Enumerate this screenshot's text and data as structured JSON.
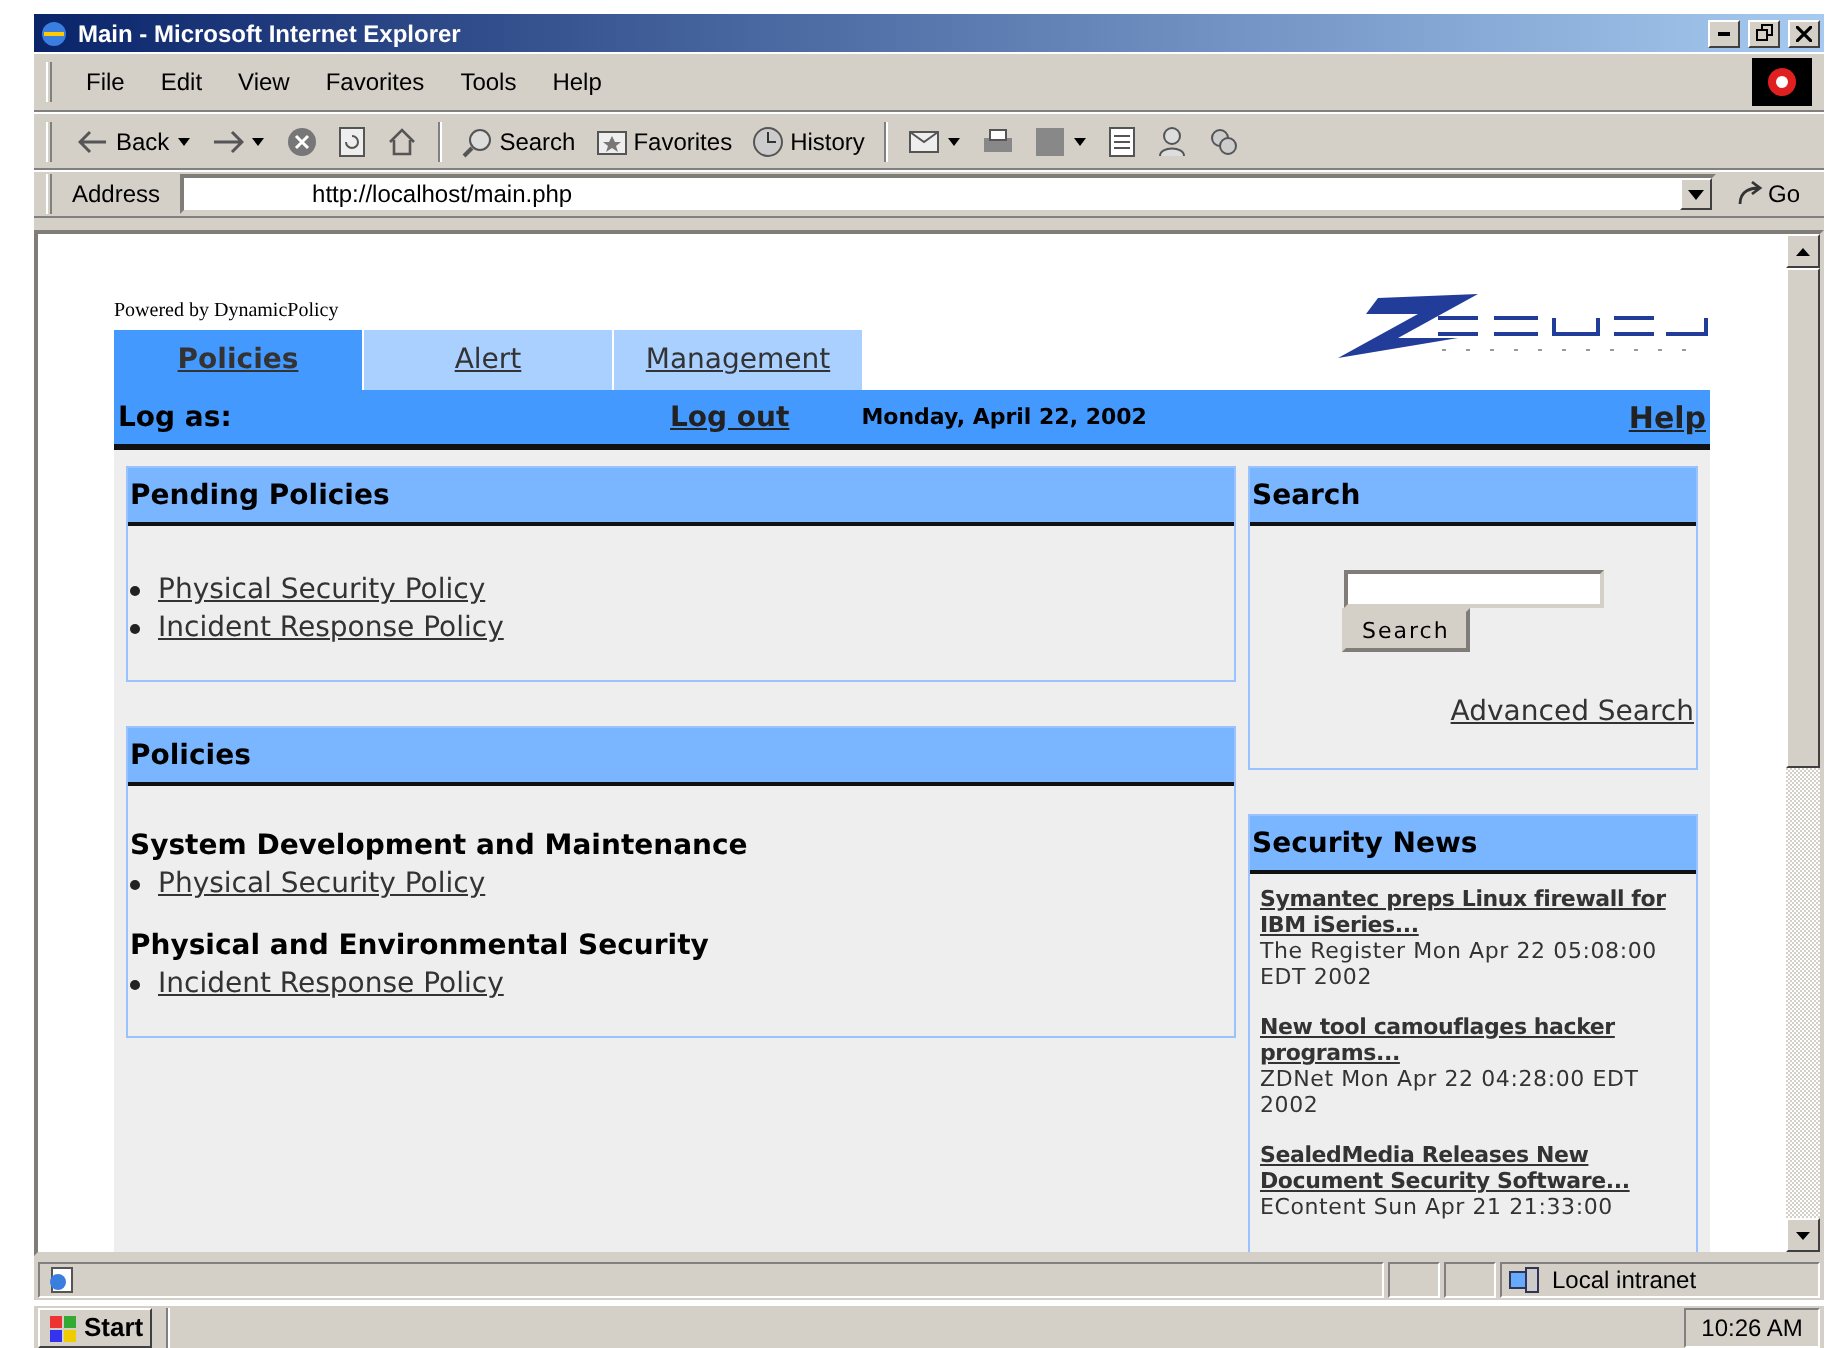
{
  "window": {
    "title": "Main - Microsoft Internet Explorer"
  },
  "menu": [
    "File",
    "Edit",
    "View",
    "Favorites",
    "Tools",
    "Help"
  ],
  "toolbar": {
    "back": "Back",
    "search": "Search",
    "favorites": "Favorites",
    "history": "History"
  },
  "address": {
    "label": "Address",
    "url": "http://localhost/main.php",
    "go": "Go"
  },
  "page": {
    "powered_by": "Powered by DynamicPolicy",
    "tabs": [
      {
        "label": "Policies",
        "selected": true
      },
      {
        "label": "Alert",
        "selected": false
      },
      {
        "label": "Management",
        "selected": false
      }
    ],
    "user_bar": {
      "log_as": "Log as:",
      "logout": "Log out",
      "date": "Monday, April 22, 2002",
      "help": "Help"
    },
    "pending": {
      "title": "Pending Policies",
      "items": [
        "Physical Security Policy",
        "Incident Response Policy"
      ]
    },
    "policies": {
      "title": "Policies",
      "groups": [
        {
          "heading": "System Development and Maintenance",
          "items": [
            "Physical Security Policy"
          ]
        },
        {
          "heading": "Physical and Environmental Security",
          "items": [
            "Incident Response Policy"
          ]
        }
      ]
    },
    "search": {
      "title": "Search",
      "button": "Search",
      "advanced": "Advanced Search"
    },
    "news": {
      "title": "Security News",
      "items": [
        {
          "headline": "Symantec preps Linux firewall for IBM iSeries...",
          "meta": "The Register  Mon Apr 22 05:08:00 EDT 2002"
        },
        {
          "headline": "New tool camouflages hacker programs...",
          "meta": "ZDNet  Mon Apr 22 04:28:00 EDT 2002"
        },
        {
          "headline": "SealedMedia Releases New Document Security Software...",
          "meta": "EContent  Sun Apr 21 21:33:00"
        }
      ]
    }
  },
  "status_bar": {
    "zone": "Local intranet"
  },
  "taskbar": {
    "start": "Start",
    "clock": "10:26 AM"
  }
}
